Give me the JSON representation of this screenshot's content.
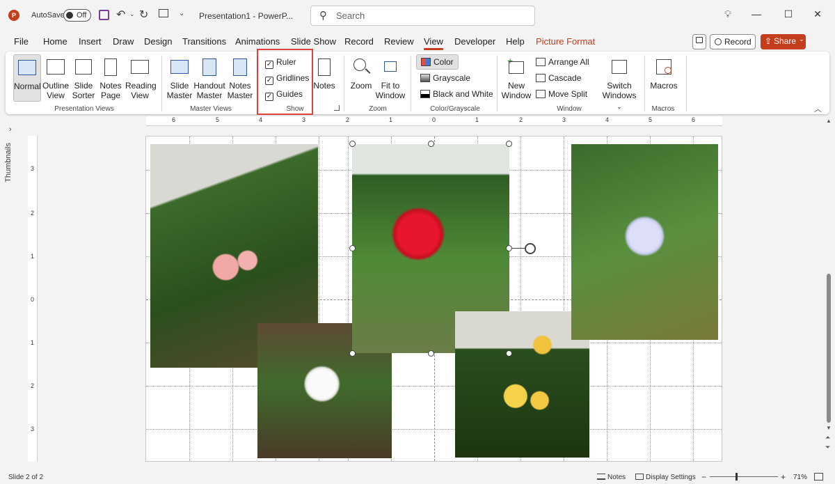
{
  "titlebar": {
    "autosave_label": "AutoSave",
    "autosave_state": "Off",
    "doc_title": "Presentation1  -  PowerP...",
    "search_placeholder": "Search"
  },
  "menu": {
    "tabs": [
      "File",
      "Home",
      "Insert",
      "Draw",
      "Design",
      "Transitions",
      "Animations",
      "Slide Show",
      "Record",
      "Review",
      "View",
      "Developer",
      "Help",
      "Picture Format"
    ],
    "active_tab": "View",
    "record_label": "Record",
    "share_label": "Share"
  },
  "ribbon": {
    "presentation_views": {
      "label": "Presentation Views",
      "buttons": [
        {
          "line1": "Normal",
          "line2": ""
        },
        {
          "line1": "Outline",
          "line2": "View"
        },
        {
          "line1": "Slide",
          "line2": "Sorter"
        },
        {
          "line1": "Notes",
          "line2": "Page"
        },
        {
          "line1": "Reading",
          "line2": "View"
        }
      ]
    },
    "master_views": {
      "label": "Master Views",
      "buttons": [
        {
          "line1": "Slide",
          "line2": "Master"
        },
        {
          "line1": "Handout",
          "line2": "Master"
        },
        {
          "line1": "Notes",
          "line2": "Master"
        }
      ]
    },
    "show": {
      "label": "Show",
      "checks": [
        {
          "label": "Ruler",
          "checked": true
        },
        {
          "label": "Gridlines",
          "checked": true
        },
        {
          "label": "Guides",
          "checked": true
        }
      ],
      "notes_button": "Notes"
    },
    "zoom": {
      "label": "Zoom",
      "zoom_button": "Zoom",
      "fit_line1": "Fit to",
      "fit_line2": "Window"
    },
    "color": {
      "label": "Color/Grayscale",
      "items": [
        "Color",
        "Grayscale",
        "Black and White"
      ]
    },
    "window": {
      "label": "Window",
      "new_line1": "New",
      "new_line2": "Window",
      "items": [
        "Arrange All",
        "Cascade",
        "Move Split"
      ],
      "switch_line1": "Switch",
      "switch_line2": "Windows"
    },
    "macros": {
      "label": "Macros",
      "button": "Macros"
    }
  },
  "rulers": {
    "horizontal": [
      "6",
      "5",
      "4",
      "3",
      "2",
      "1",
      "0",
      "1",
      "2",
      "3",
      "4",
      "5",
      "6"
    ],
    "vertical": [
      "3",
      "2",
      "1",
      "0",
      "1",
      "2",
      "3"
    ]
  },
  "sidebar": {
    "thumbnails_label": "Thumbnails"
  },
  "status": {
    "slide_info": "Slide 2 of 2",
    "notes_label": "Notes",
    "display_settings": "Display Settings",
    "zoom_level": "71%",
    "zoom_minus": "−",
    "zoom_plus": "+"
  },
  "colors": {
    "accent": "#c43e1c",
    "highlight_box": "#e0413a"
  }
}
